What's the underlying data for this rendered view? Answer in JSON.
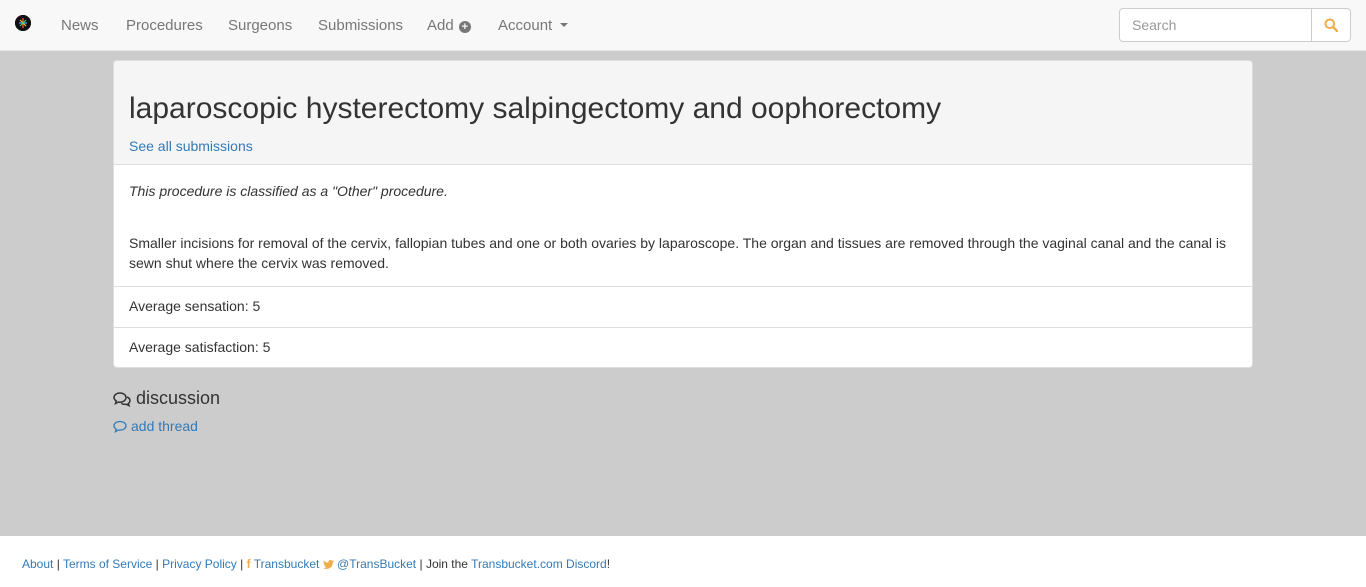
{
  "nav": {
    "items": [
      "News",
      "Procedures",
      "Surgeons",
      "Submissions"
    ],
    "add_label": "Add",
    "account_label": "Account",
    "search_placeholder": "Search"
  },
  "procedure": {
    "title": "laparoscopic hysterectomy salpingectomy and oophorectomy",
    "see_all": "See all submissions",
    "classification": "This procedure is classified as a \"Other\" procedure.",
    "description": "Smaller incisions for removal of the cervix, fallopian tubes and one or both ovaries by laparoscope. The organ and tissues are removed through the vaginal canal and the canal is sewn shut where the cervix was removed.",
    "avg_sensation": "Average sensation: 5",
    "avg_satisfaction": "Average satisfaction: 5"
  },
  "discussion": {
    "heading": "discussion",
    "add_thread": "add thread"
  },
  "footer": {
    "about": "About",
    "terms": "Terms of Service",
    "privacy": "Privacy Policy",
    "facebook": "Transbucket",
    "twitter": "@TransBucket",
    "join_text": "Join the",
    "discord": "Transbucket.com Discord",
    "exclaim": "!"
  },
  "colors": {
    "link": "#337ab7",
    "accent": "#f0ad4e",
    "background": "#cccccc"
  }
}
